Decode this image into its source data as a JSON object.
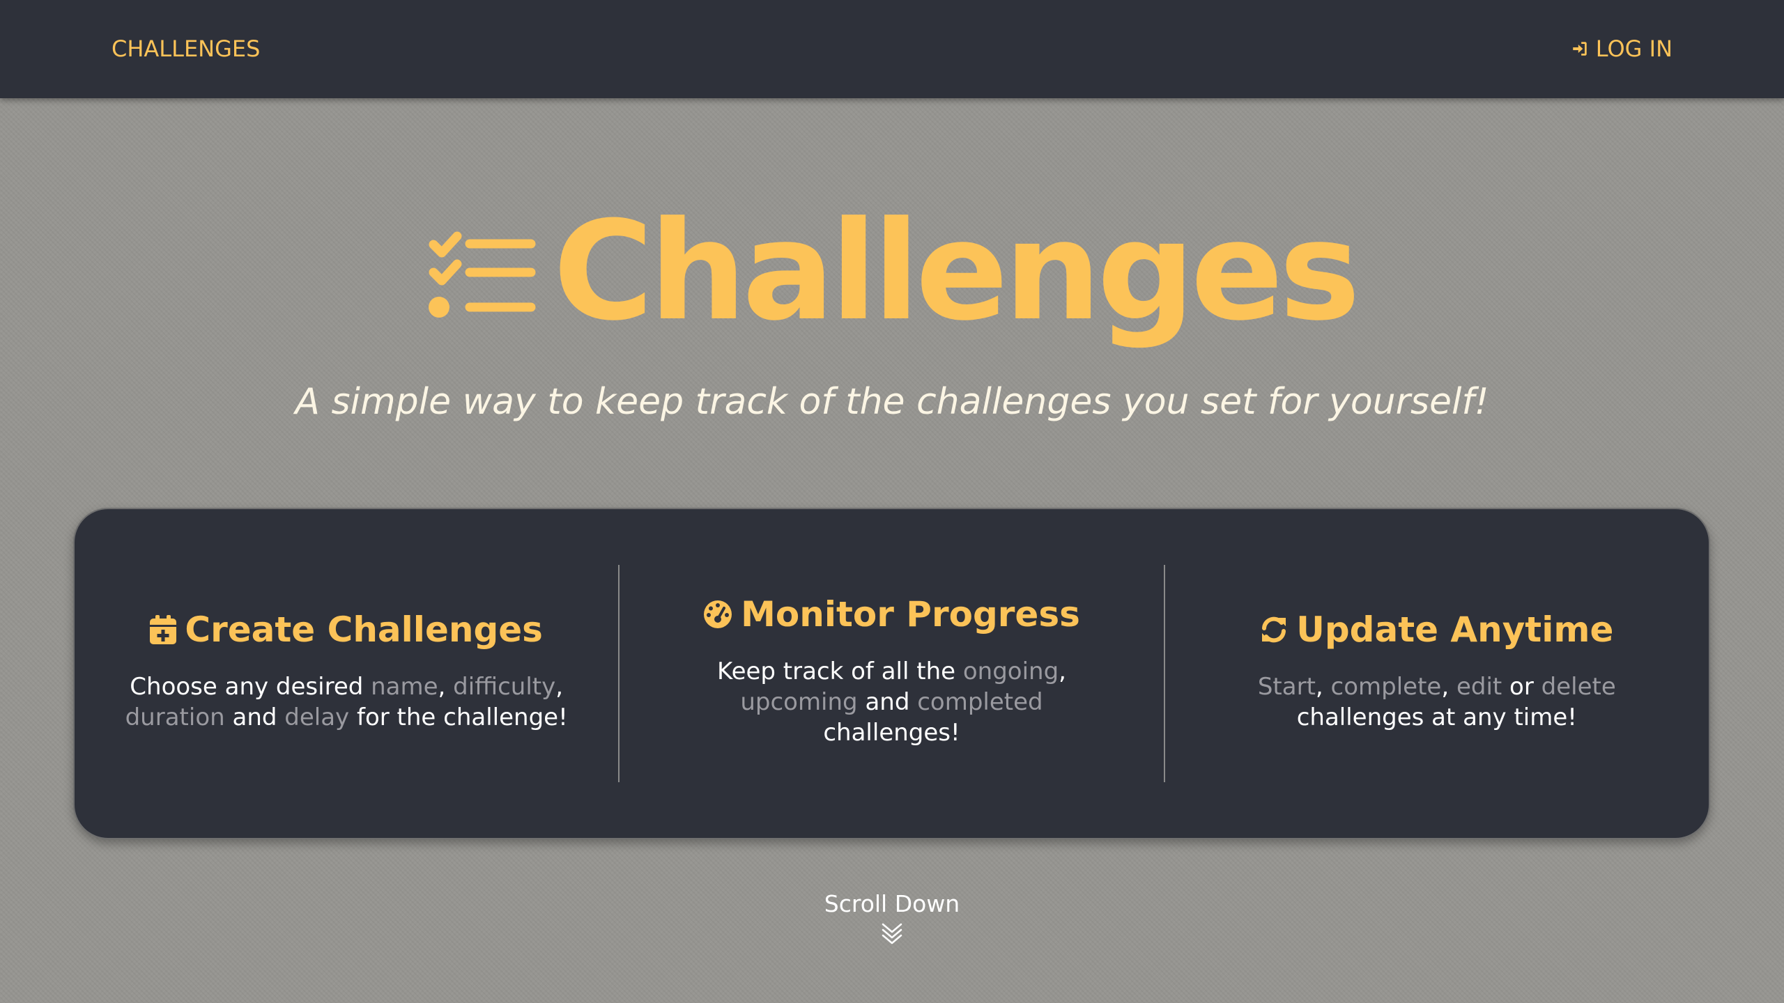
{
  "nav": {
    "brand": "CHALLENGES",
    "login_label": "LOG IN",
    "login_icon": "sign-in-icon"
  },
  "hero": {
    "title": "Challenges",
    "icon": "checklist-icon",
    "tagline": "A simple way to keep track of the challenges you set for yourself!"
  },
  "features": [
    {
      "icon": "calendar-plus-icon",
      "title": "Create Challenges",
      "desc": {
        "p1": "Choose any desired ",
        "h1": "name",
        "p2": ", ",
        "h2": "difficulty",
        "p3": ", ",
        "h3": "duration",
        "p4": " and ",
        "h4": "delay",
        "p5": " for the challenge!"
      }
    },
    {
      "icon": "gauge-icon",
      "title": "Monitor Progress",
      "desc": {
        "p1": "Keep track of all the ",
        "h1": "ongoing",
        "p2": ", ",
        "h2": "upcoming",
        "p3": " and ",
        "h3": "completed",
        "p4": " challenges!"
      }
    },
    {
      "icon": "refresh-icon",
      "title": "Update Anytime",
      "desc": {
        "h1": "Start",
        "p1": ", ",
        "h2": "complete",
        "p2": ", ",
        "h3": "edit",
        "p3": " or ",
        "h4": "delete",
        "p4": " challenges at any time!"
      }
    }
  ],
  "scroll": {
    "label": "Scroll Down",
    "icon": "double-chevron-down-icon"
  },
  "colors": {
    "accent": "#fcc358",
    "nav_bg": "#2e313a",
    "page_bg": "#969591",
    "muted_text": "#9a9aa0"
  }
}
